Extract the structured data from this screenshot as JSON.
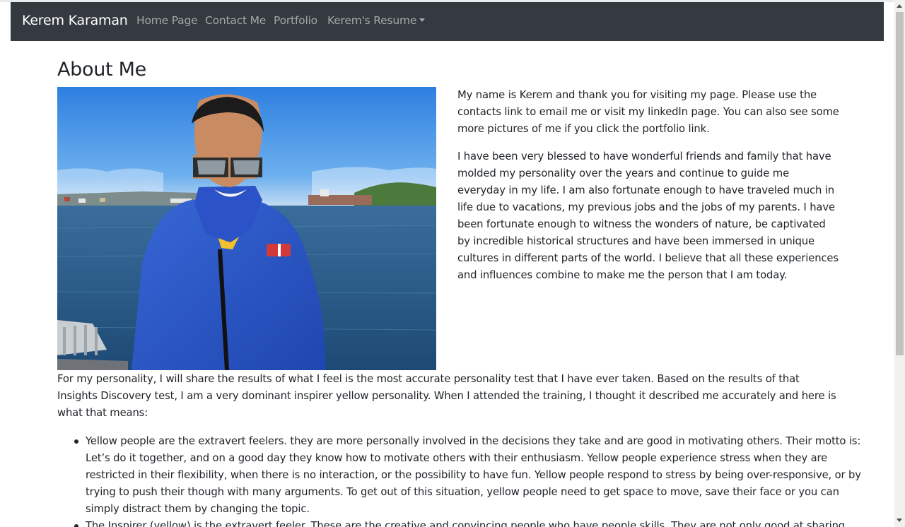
{
  "nav": {
    "brand": "Kerem Karaman",
    "links": [
      "Home Page",
      "Contact Me",
      "Portfolio"
    ],
    "dropdown_label": "Kerem's Resume"
  },
  "main": {
    "heading": "About Me",
    "intro_paragraphs": [
      "My name is Kerem and thank you for visiting my page. Please use the contacts link to email me or visit my linkedIn page. You can also see some more pictures of me if you click the portfolio link.",
      "I have been very blessed to have wonderful friends and family that have molded my personality over the years and continue to guide me everyday in my life. I am also fortunate enough to have traveled much in life due to vacations, my previous jobs and the jobs of my parents. I have been fortunate enough to witness the wonders of nature, be captivated by incredible historical structures and have been immersed in unique cultures in different parts of the world. I believe that all these experiences and influences combine to make me the person that I am today."
    ],
    "personality_intro": "For my personality, I will share the results of what I feel is the most accurate personality test that I have ever taken. Based on the results of that Insights Discovery test, I am a very dominant inspirer yellow personality. When I attended the training, I thought it described me accurately and here is what that means:",
    "traits": [
      "Yellow people are the extravert feelers. they are more personally involved in the decisions they take and are good in motivating others. Their motto is: Let’s do it together, and on a good day they know how to motivate others with their enthusiasm. Yellow people experience stress when they are restricted in their flexibility, when there is no interaction, or the possibility to have fun. Yellow people respond to stress by being over-responsive, or by trying to push their though with many arguments. To get out of this situation, yellow people need to get space to move, save their face or you can simply distract them by changing the topic.",
      "The Inspirer (yellow) is the extravert feeler. These are the creative and convincing people who have people skills. They are not only good at sharing their"
    ]
  },
  "colors": {
    "navbar_bg": "#343a40",
    "brand_text": "#ffffff",
    "nav_link_text": "rgba(255,255,255,0.55)",
    "body_text": "#212529",
    "sweater_blue": "#2a52c0",
    "sky_blue": "#3a8be4",
    "water_blue": "#23527f"
  },
  "icons": {
    "dropdown": "caret-down-icon"
  }
}
